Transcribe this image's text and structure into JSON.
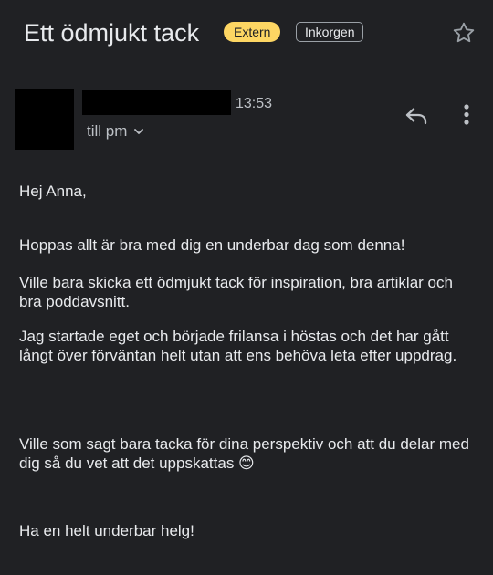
{
  "email": {
    "subject": "Ett ödmjukt tack",
    "label_external": "Extern",
    "label_inbox": "Inkorgen",
    "time": "13:53",
    "recipient": "till pm",
    "body": {
      "greeting": "Hej Anna,",
      "p1": "Hoppas allt är bra med dig en underbar dag som denna!",
      "p2": "Ville bara skicka ett ödmjukt tack för inspiration, bra artiklar och bra poddavsnitt.",
      "p3": "Jag startade eget och började frilansa i höstas och det har gått långt över förväntan helt utan att ens behöva leta efter uppdrag.",
      "p4": "Ville som sagt bara tacka för dina perspektiv och att du delar med dig så du vet att det uppskattas 😊",
      "p5": "Ha en helt underbar helg!"
    }
  },
  "colors": {
    "background": "#202124",
    "external_chip": "#fdd663",
    "text": "#e8eaed",
    "secondary_text": "#bdc1c6"
  },
  "icons": {
    "star": "star-outline-icon",
    "reply": "reply-icon",
    "more": "more-vertical-icon",
    "expand": "chevron-down-icon"
  }
}
